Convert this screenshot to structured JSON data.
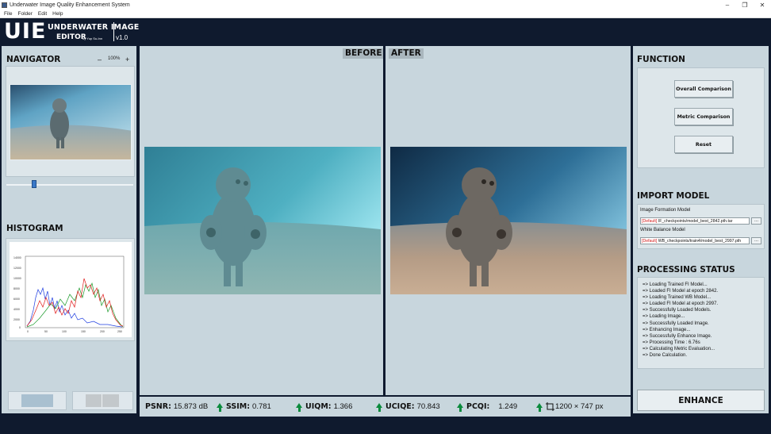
{
  "window": {
    "title": "Underwater Image Quality Enhancement System",
    "controls": [
      "–",
      "❐",
      "✕"
    ]
  },
  "menu": [
    "File",
    "Folder",
    "Edit",
    "Help"
  ],
  "banner": {
    "logo": "UIE",
    "line1": "UNDERWATER IMAGE",
    "line2": "EDITOR",
    "by": "by Yup Su-Inn",
    "version": "v1.0"
  },
  "navigator": {
    "title": "NAVIGATOR",
    "zoom_out": "–",
    "zoom": "100%",
    "zoom_in": "+",
    "slider_value": 0.22
  },
  "histogram": {
    "title": "HISTOGRAM",
    "ylabels": [
      "14000",
      "12000",
      "10000",
      "8000",
      "6000",
      "4000",
      "2000",
      "0"
    ],
    "xlabels": [
      "0",
      "50",
      "100",
      "150",
      "200",
      "250"
    ]
  },
  "views": {
    "before": "BEFORE",
    "after": "AFTER"
  },
  "metrics": {
    "psnr_label": "PSNR:",
    "psnr_value": "15.873 dB",
    "ssim_label": "SSIM:",
    "ssim_value": "0.781",
    "uiqm_label": "UIQM:",
    "uiqm_value": "1.366",
    "uciqe_label": "UCIQE:",
    "uciqe_value": "70.843",
    "pcqi_label": "PCQI:",
    "pcqi_value": "1.249",
    "resolution": "1200 × 747 px",
    "arrow_color": "#0a8a3c"
  },
  "function": {
    "title": "FUNCTION",
    "overall": "Overall Comparison",
    "metric": "Metric Comparison",
    "reset": "Reset"
  },
  "import": {
    "title": "IMPORT MODEL",
    "fi_label": "Image Formation Model",
    "fi_default": "[Default]",
    "fi_path": " IF_checkpoints/model_best_2842.pth.tar",
    "wb_label": "White Balance Model",
    "wb_default": "[Default]",
    "wb_path": " WB_checkpoints/train4/model_best_2997.pth",
    "browse": "..."
  },
  "status": {
    "title": "PROCESSING STATUS",
    "lines": [
      "=> Loading Trained FI Model...",
      "=> Loaded FI Model at epoch 2842.",
      "=> Loading Trained WB Model...",
      "=> Loaded FI Model at epoch 2997.",
      "=> Successfully Loaded Models.",
      "=> Loading Image...",
      "=> Successfully Loaded Image.",
      "=> Enhancing Image...",
      "=> Successfully Enhance Image.",
      "=> Processing Time : 6.76s",
      "=> Calculating Metric Evaluation...",
      "=> Done Calculation."
    ]
  },
  "enhance_button": "ENHANCE",
  "colors": {
    "dark_bg": "#0f1a2e",
    "panel": "#c8d6dd",
    "box": "#dde6ea",
    "accent": "#3a78c8",
    "default_red": "#d42020"
  }
}
